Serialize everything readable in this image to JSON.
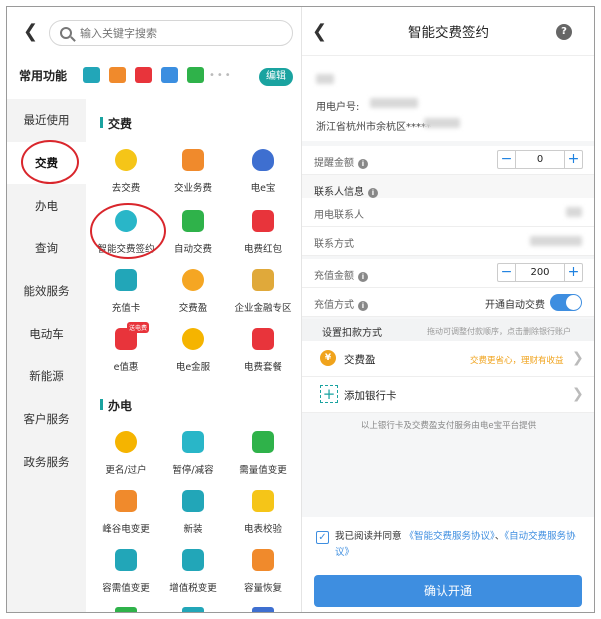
{
  "left": {
    "search_placeholder": "输入关键字搜索",
    "common_title": "常用功能",
    "edit_label": "编辑",
    "more_dots": "•••",
    "sidebar": [
      "最近使用",
      "交费",
      "办电",
      "查询",
      "能效服务",
      "电动车",
      "新能源",
      "客户服务",
      "政务服务"
    ],
    "active_sidebar": "交费",
    "section_fee": "交费",
    "section_power": "办电",
    "fee_tiles": [
      "去交费",
      "交业务费",
      "电e宝",
      "智能交费签约",
      "自动交费",
      "电费红包",
      "充值卡",
      "交费盈",
      "企业金融专区",
      "e值惠",
      "电e金服",
      "电费套餐"
    ],
    "power_tiles": [
      "更名/过户",
      "暂停/减容",
      "需量值变更",
      "峰谷电变更",
      "新装",
      "电表校验",
      "容需值变更",
      "增值税变更",
      "容量恢复"
    ],
    "badge_new": "送电费"
  },
  "right": {
    "title": "智能交费签约",
    "help": "?",
    "account_no_label": "用电户号:",
    "address": "浙江省杭州市余杭区*****",
    "remind_label": "提醒金额",
    "remind_value": "0",
    "contact_header": "联系人信息",
    "contact_label": "用电联系人",
    "phone_label": "联系方式",
    "recharge_label": "充值金额",
    "recharge_value": "200",
    "recharge_mode_label": "充值方式",
    "auto_label": "开通自动交费",
    "pay_method_label": "设置扣款方式",
    "pay_method_hint": "拖动可调整付款顺序，点击删除银行账户",
    "jfy_label": "交费盈",
    "jfy_promo": "交费更省心，理财有收益",
    "add_bank": "添加银行卡",
    "footer_note": "以上银行卡及交费盈支付服务由电e宝平台提供",
    "agree_prefix": "我已阅读并同意",
    "agree_link1": "《智能交费服务协议》",
    "agree_sep": "、",
    "agree_link2": "《自动交费服务协议》",
    "confirm": "确认开通"
  },
  "colors": {
    "teal": "#1aa3a0",
    "blue": "#3e8ee0",
    "red": "#d9262c",
    "orange": "#f0a31c"
  }
}
